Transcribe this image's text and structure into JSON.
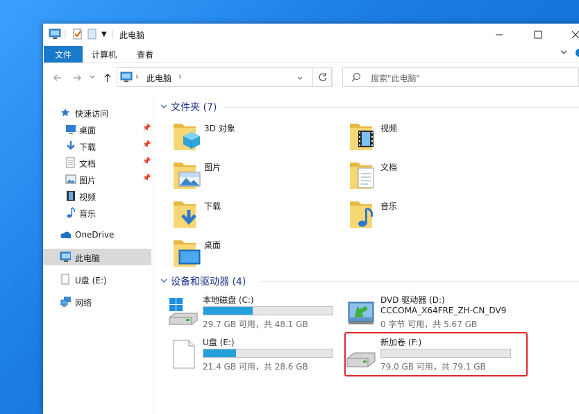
{
  "window": {
    "title": "此电脑"
  },
  "ribbon": {
    "tabs": [
      {
        "label": "文件"
      },
      {
        "label": "计算机"
      },
      {
        "label": "查看"
      }
    ]
  },
  "address": {
    "path": [
      "此电脑"
    ],
    "search_placeholder": "搜索\"此电脑\""
  },
  "nav": {
    "quick_access": "快速访问",
    "items": [
      {
        "label": "桌面",
        "pinned": true
      },
      {
        "label": "下载",
        "pinned": true
      },
      {
        "label": "文档",
        "pinned": true
      },
      {
        "label": "图片",
        "pinned": true
      },
      {
        "label": "视频",
        "pinned": false
      },
      {
        "label": "音乐",
        "pinned": false
      }
    ],
    "onedrive": "OneDrive",
    "this_pc": "此电脑",
    "usb": "U盘 (E:)",
    "network": "网络"
  },
  "folders": {
    "header": "文件夹 (7)",
    "items": [
      {
        "label": "3D 对象",
        "icon": "3d-objects-folder-icon"
      },
      {
        "label": "视频",
        "icon": "videos-folder-icon"
      },
      {
        "label": "图片",
        "icon": "pictures-folder-icon"
      },
      {
        "label": "文档",
        "icon": "documents-folder-icon"
      },
      {
        "label": "下载",
        "icon": "downloads-folder-icon"
      },
      {
        "label": "音乐",
        "icon": "music-folder-icon"
      },
      {
        "label": "桌面",
        "icon": "desktop-folder-icon"
      }
    ]
  },
  "drives": {
    "header": "设备和驱动器 (4)",
    "items": [
      {
        "name": "本地磁盘 (C:)",
        "subtitle": "29.7 GB 可用，共 48.1 GB",
        "used_fraction": 0.38,
        "bar": true
      },
      {
        "name": "DVD 驱动器 (D:)",
        "line2": "CCCOMA_X64FRE_ZH-CN_DV9",
        "subtitle": "0 字节 可用，共 5.67 GB",
        "bar": false
      },
      {
        "name": "U盘 (E:)",
        "subtitle": "21.4 GB 可用，共 28.6 GB",
        "used_fraction": 0.25,
        "bar": true
      },
      {
        "name": "新加卷 (F:)",
        "subtitle": "79.0 GB 可用，共 79.1 GB",
        "used_fraction": 0.0,
        "bar": true,
        "highlighted": true
      }
    ]
  },
  "colors": {
    "accent": "#1979ca",
    "bar_fill": "#26a0da",
    "highlight": "#e0262b"
  }
}
